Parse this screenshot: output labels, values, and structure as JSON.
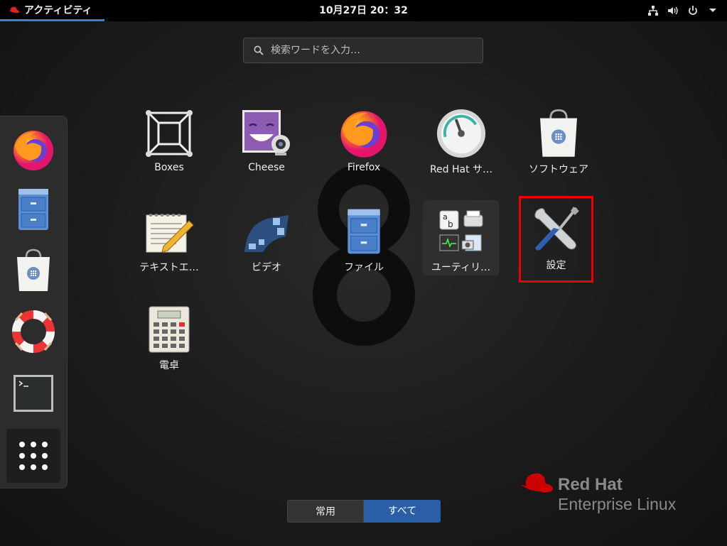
{
  "topbar": {
    "activities_label": "アクティビティ",
    "clock": "10月27日  20：32",
    "icons": [
      "network-icon",
      "volume-icon",
      "power-icon",
      "menu-arrow-icon"
    ]
  },
  "search": {
    "placeholder": "検索ワードを入力…"
  },
  "dash": {
    "items": [
      "firefox-icon",
      "files-icon",
      "software-icon",
      "help-icon",
      "terminal-icon",
      "show-apps-icon"
    ]
  },
  "apps": [
    {
      "label": "Boxes",
      "icon": "boxes-icon"
    },
    {
      "label": "Cheese",
      "icon": "cheese-icon"
    },
    {
      "label": "Firefox",
      "icon": "firefox-icon"
    },
    {
      "label": "Red Hat サ…",
      "icon": "gauge-icon"
    },
    {
      "label": "ソフトウェア",
      "icon": "software-icon"
    },
    {
      "label": "テキストエ…",
      "icon": "text-editor-icon"
    },
    {
      "label": "ビデオ",
      "icon": "video-icon"
    },
    {
      "label": "ファイル",
      "icon": "files-icon"
    },
    {
      "label": "ユーティリ…",
      "icon": "utilities-folder-icon"
    },
    {
      "label": "設定",
      "icon": "settings-icon",
      "highlighted": true
    },
    {
      "label": "電卓",
      "icon": "calculator-icon"
    }
  ],
  "view_toggle": {
    "frequent": "常用",
    "all": "すべて",
    "selected": "all"
  },
  "branding": {
    "line1": "Red Hat",
    "line2": "Enterprise Linux"
  },
  "colors": {
    "accent": "#2a5fa8",
    "highlight": "#e00000",
    "brand_red": "#c00"
  }
}
